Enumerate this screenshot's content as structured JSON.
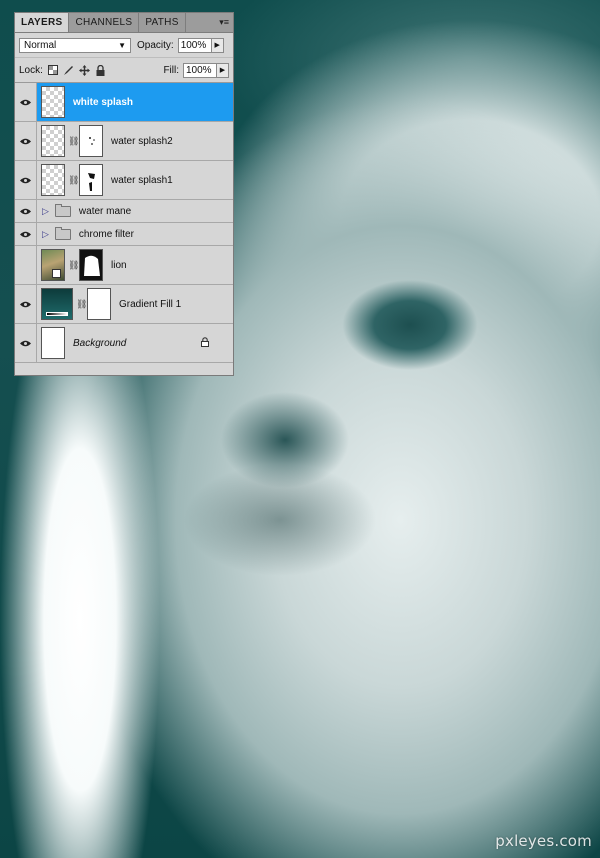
{
  "panel": {
    "tabs": [
      {
        "label": "LAYERS",
        "active": true
      },
      {
        "label": "CHANNELS",
        "active": false
      },
      {
        "label": "PATHS",
        "active": false
      }
    ],
    "menu_glyph": "▾≡",
    "blend_mode": "Normal",
    "opacity_label": "Opacity:",
    "opacity_value": "100%",
    "lock_label": "Lock:",
    "fill_label": "Fill:",
    "fill_value": "100%"
  },
  "layers": [
    {
      "name": "white  splash",
      "visible": true,
      "selected": true,
      "type": "empty"
    },
    {
      "name": "water splash2",
      "visible": true,
      "selected": false,
      "type": "masked"
    },
    {
      "name": "water splash1",
      "visible": true,
      "selected": false,
      "type": "masked"
    },
    {
      "name": "water mane",
      "visible": true,
      "selected": false,
      "type": "group"
    },
    {
      "name": "chrome filter",
      "visible": true,
      "selected": false,
      "type": "group"
    },
    {
      "name": "lion",
      "visible": false,
      "selected": false,
      "type": "image-masked"
    },
    {
      "name": "Gradient Fill 1",
      "visible": true,
      "selected": false,
      "type": "gradient"
    },
    {
      "name": "Background",
      "visible": true,
      "selected": false,
      "type": "background"
    }
  ],
  "watermark": "pxleyes.com",
  "colors": {
    "selection": "#1d9bf0",
    "panel_bg": "#d6d6d6",
    "artwork_dark": "#0e4b4b"
  }
}
